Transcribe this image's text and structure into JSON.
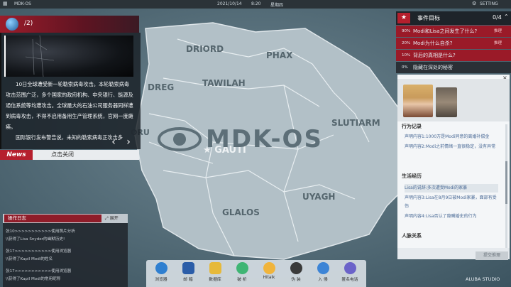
{
  "topbar": {
    "app": "MDK-OS",
    "date": "2021/10/14",
    "time": "8:20",
    "weekday": "星期四",
    "setting": "SETTING"
  },
  "map": {
    "watermark": "MDK-OS",
    "regions": [
      "DRIORD",
      "PHAX",
      "TAWILAH",
      "DREG",
      "SLUTIARM",
      "GAUTI",
      "UYAGH",
      "GLALOS",
      "ORU"
    ]
  },
  "news": {
    "page": "/2)",
    "paragraph1": "10日全球遭受新一轮勒索病毒攻击。本轮勒索病毒攻击范围广泛，多个国家的政府机构、中央银行、能源及通信系统等均遭攻击。全球最大的石油公司服务器同样遭到病毒攻击，不得不启用备用生产管理系统，官网一度瘫痪。",
    "paragraph2": "国际银行发布警告说，未知的勒索病毒正攻击多",
    "tab_label": "News",
    "close_label": "点击关闭",
    "prev": "‹",
    "next": "›"
  },
  "log": {
    "title": "操作日志",
    "expand": "展开",
    "lines": [
      "张10>>>>>>>>>>>使用照片分析",
      "\\\\获得了Lisa Snyder的幽默历史!",
      "张17>>>>>>>>>>>使用浏览器",
      "\\\\获得了Kapil Modi的姓名",
      "张17>>>>>>>>>>>使用浏览器",
      "\\\\获得了Kapil Modi的常用昵称"
    ]
  },
  "dock": {
    "items": [
      {
        "label": "浏览器",
        "color": "#2f7fd0"
      },
      {
        "label": "邮 箱",
        "color": "#2b5da8"
      },
      {
        "label": "数据库",
        "color": "#e6b93a"
      },
      {
        "label": "破 析",
        "color": "#3fb574"
      },
      {
        "label": "Hitalk",
        "color": "#f0b43c"
      },
      {
        "label": "伪 装",
        "color": "#3a3a3a"
      },
      {
        "label": "入 侵",
        "color": "#3c84d6"
      },
      {
        "label": "匿名电话",
        "color": "#6b63c9"
      }
    ]
  },
  "events": {
    "title": "事件目标",
    "count": "0/4",
    "items": [
      {
        "pct": "90%",
        "text": "Modi和Lisa之间发生了什么?",
        "tag": "推理"
      },
      {
        "pct": "20%",
        "text": "Modi为什么自杀?",
        "tag": "推理"
      },
      {
        "pct": "10%",
        "text": "背后的真相是什么?",
        "tag": ""
      },
      {
        "pct": "0%",
        "text": "隐藏在深处的秘密",
        "tag": ""
      }
    ]
  },
  "profile": {
    "section1": "行为记录",
    "s1_items": [
      "声明内容1:1000万是Modi同意的离婚补偿金",
      "声明内容2:Modi之前情绪一直很稳定，没有异常"
    ],
    "section2": "生活经历",
    "s2_items": [
      "Lisa的说辞:多次遭受Modi的家暴",
      "声明内容3:Lisa在8月9日被Modi家暴，面部有受伤",
      "声明内容4:Lisa否认了隐瞒婚史的行为"
    ],
    "section3": "人脉关系",
    "confirm": "提交推理"
  },
  "brand": "ALUBA STUDIO"
}
